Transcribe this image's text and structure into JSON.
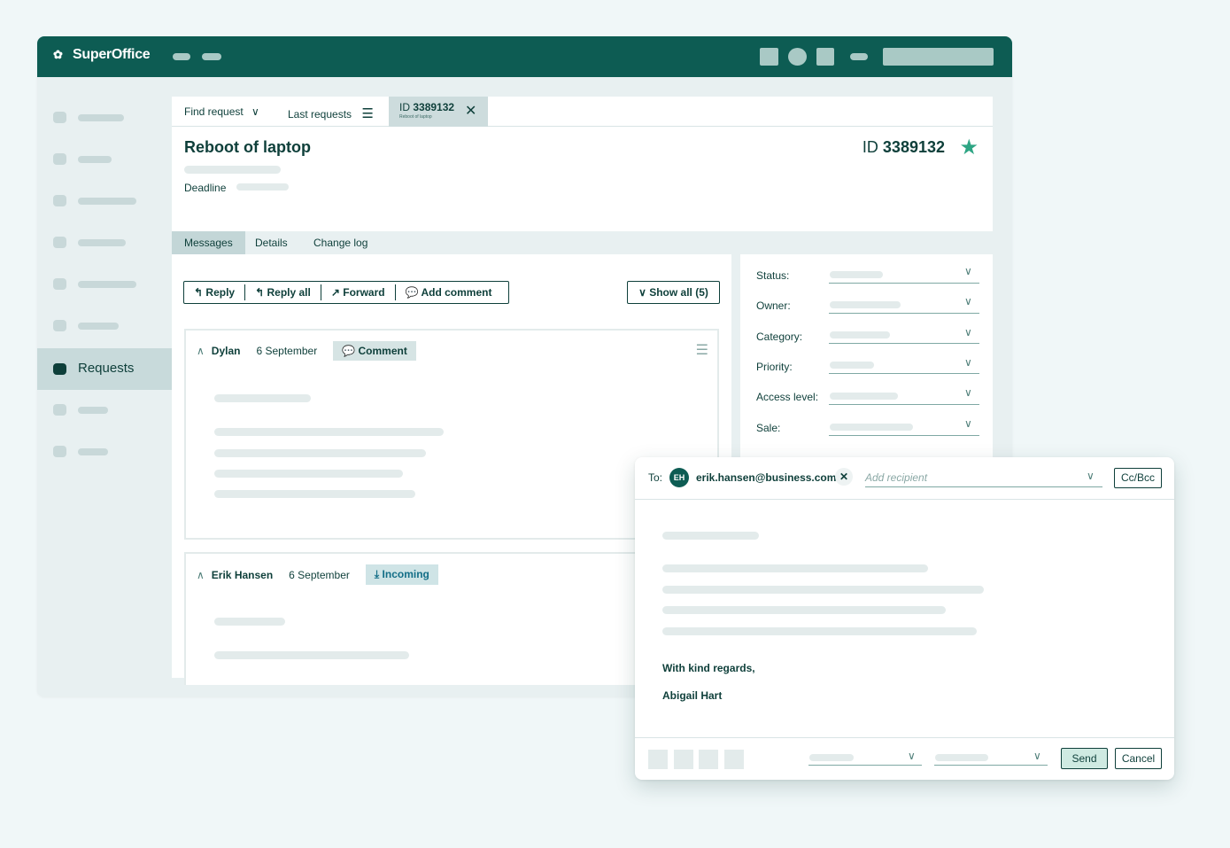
{
  "app": {
    "brand": "SuperOffice"
  },
  "sidebar": {
    "active_label": "Requests"
  },
  "tabs": {
    "find_request": "Find request",
    "last_requests": "Last requests",
    "ticket_id_prefix": "ID",
    "ticket_id": "3389132",
    "ticket_subtitle": "Reboot of laptop"
  },
  "request": {
    "title": "Reboot of laptop",
    "id_prefix": "ID",
    "id": "3389132",
    "deadline_label": "Deadline"
  },
  "subtabs": [
    "Messages",
    "Details",
    "Change log"
  ],
  "toolbar": {
    "reply": "Reply",
    "reply_all": "Reply all",
    "forward": "Forward",
    "add_comment": "Add comment",
    "show_all": "Show all (5)"
  },
  "messages": [
    {
      "author": "Dylan",
      "date": "6 September",
      "badge": "Comment"
    },
    {
      "author": "Erik Hansen",
      "date": "6 September",
      "badge": "Incoming"
    }
  ],
  "fields": [
    "Status:",
    "Owner:",
    "Category:",
    "Priority:",
    "Access level:",
    "Sale:"
  ],
  "compose": {
    "to_label": "To:",
    "avatar_initials": "EH",
    "recipient": "erik.hansen@business.com",
    "add_recipient_placeholder": "Add recipient",
    "cc_bcc": "Cc/Bcc",
    "closing": "With kind regards,",
    "signature": "Abigail Hart",
    "send": "Send",
    "cancel": "Cancel"
  },
  "colors": {
    "header": "#0d5c53",
    "accent": "#2ea584",
    "send_bg": "#cfeae2"
  }
}
